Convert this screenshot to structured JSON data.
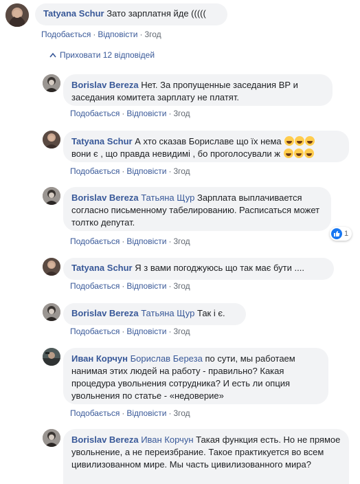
{
  "thread": {
    "hide_replies_label": "Приховати 12 відповідей",
    "like_label": "Подобається",
    "reply_label": "Відповісти",
    "separator": "·"
  },
  "comments": [
    {
      "author": "Tatyana Schur",
      "mention": "",
      "text": "Зато зарплатня йде (((((",
      "time": "3год",
      "reactions": ""
    },
    {
      "author": "Borislav Bereza",
      "mention": "",
      "text": "Нет. За пропущенные заседания ВР и заседания комитета зарплату не платят.",
      "time": "3год",
      "reactions": ""
    },
    {
      "author": "Tatyana Schur",
      "mention": "",
      "text_line1": "А хто сказав Бориславе що їх нема",
      "text_line2": "вони є , що правда невидимі , бо проголосували ж",
      "emoji": "😂",
      "time": "3год",
      "reactions": ""
    },
    {
      "author": "Borislav Bereza",
      "mention": "Татьяна Щур",
      "text": "Зарплата выплачивается согласно письменному табелированию. Расписаться может толтко депутат.",
      "time": "3год",
      "reactions": "1"
    },
    {
      "author": "Tatyana Schur",
      "mention": "",
      "text": "Я з вами погоджуюсь що так має бути ....",
      "time": "3год",
      "reactions": ""
    },
    {
      "author": "Borislav Bereza",
      "mention": "Татьяна Щур",
      "text": "Так і є.",
      "time": "3год",
      "reactions": ""
    },
    {
      "author": "Иван Корчун",
      "mention": "Борислав Береза",
      "text": "по сути, мы работаем нанимая этих людей на работу - правильно? Какая процедура увольнения сотрудника? И есть ли опция увольнения по статье - «недоверие»",
      "time": "3год",
      "reactions": ""
    },
    {
      "author": "Borislav Bereza",
      "mention": "Иван Корчун",
      "text": "Такая функция есть. Но не прямое увольнение, а не переизбрание. Такое практикуется во всем цивилизованном мире. Мы часть цивилизованного мира?",
      "time": "",
      "reactions": ""
    }
  ],
  "colors": {
    "link": "#385898",
    "bubble": "#f2f3f5",
    "meta": "#606770",
    "like_badge": "#1877f2"
  }
}
